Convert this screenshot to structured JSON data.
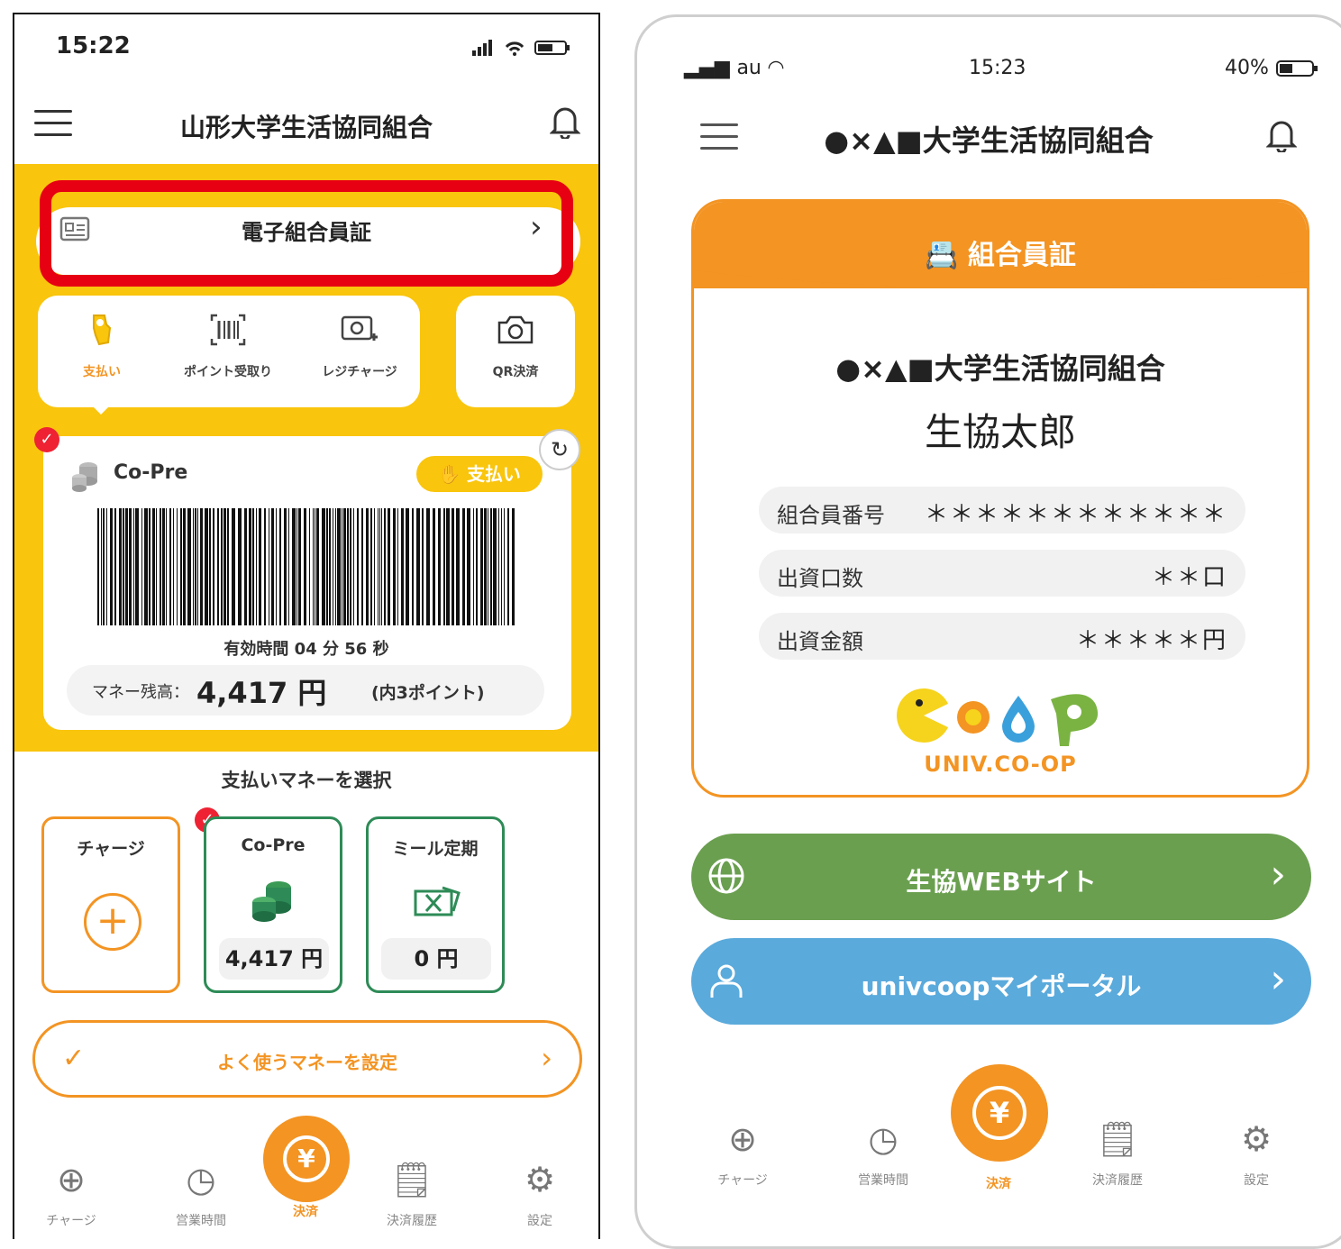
{
  "left_phone": {
    "status": {
      "time": "15:22",
      "signal": "▂▄▆ ◡ ▮"
    },
    "header": {
      "title": "山形大学生活協同組合"
    },
    "member_card_button": {
      "label": "電子組合員証"
    },
    "actions": [
      {
        "label": "支払い",
        "icon": "pay-icon"
      },
      {
        "label": "ポイント受取り",
        "icon": "barcode-scan-icon"
      },
      {
        "label": "レジチャージ",
        "icon": "register-charge-icon"
      }
    ],
    "qr_action": {
      "label": "QR決済",
      "icon": "camera-icon"
    },
    "payment_card": {
      "name": "Co-Pre",
      "pay_pill": "支払い",
      "valid_time": "有効時間 04 分 56 秒",
      "balance_label": "マネー残高：",
      "balance_amount": "4,417 円",
      "points_note": "(内3ポイント)"
    },
    "select_money": {
      "title": "支払いマネーを選択",
      "cards": [
        {
          "title": "チャージ",
          "amount": ""
        },
        {
          "title": "Co-Pre",
          "amount": "4,417 円"
        },
        {
          "title": "ミール定期",
          "amount": "0 円"
        }
      ]
    },
    "frequent_money": {
      "label": "よく使うマネーを設定"
    },
    "tabbar": [
      {
        "label": "チャージ"
      },
      {
        "label": "営業時間"
      },
      {
        "label": "決済"
      },
      {
        "label": "決済履歴"
      },
      {
        "label": "設定"
      }
    ]
  },
  "right_phone": {
    "status": {
      "carrier": "au",
      "time": "15:23",
      "battery": "40%"
    },
    "header": {
      "title": "●×▲■大学生活協同組合"
    },
    "member_card": {
      "heading": "組合員証",
      "organization": "●×▲■大学生活協同組合",
      "name": "生協太郎",
      "rows": [
        {
          "key": "組合員番号",
          "value": "＊＊＊＊＊＊＊＊＊＊＊＊"
        },
        {
          "key": "出資口数",
          "value": "＊＊口"
        },
        {
          "key": "出資金額",
          "value": "＊＊＊＊＊円"
        }
      ],
      "logo_text": "UNIV.CO-OP"
    },
    "web_button": {
      "label": "生協WEBサイト"
    },
    "portal_button": {
      "label": "univcoopマイポータル"
    },
    "tabbar": [
      {
        "label": "チャージ"
      },
      {
        "label": "営業時間"
      },
      {
        "label": "決済"
      },
      {
        "label": "決済履歴"
      },
      {
        "label": "設定"
      }
    ]
  },
  "colors": {
    "yellow": "#f9c50d",
    "orange": "#f39423",
    "highlight_red": "#e60012",
    "green": "#6a9f4f",
    "blue": "#5aaadc"
  }
}
